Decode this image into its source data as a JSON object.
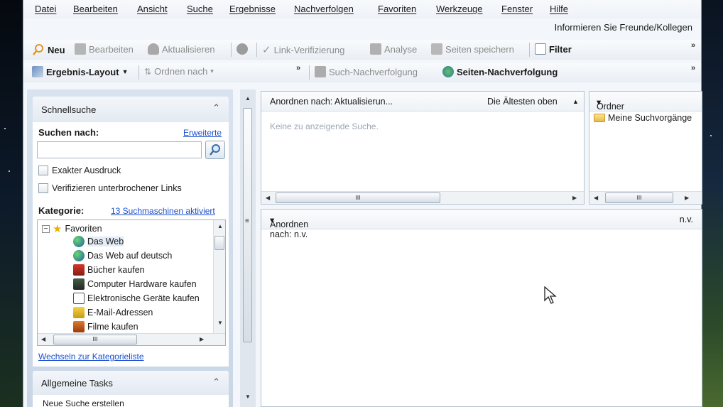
{
  "menu": [
    "Datei",
    "Bearbeiten",
    "Ansicht",
    "Suche",
    "Ergebnisse",
    "Nachverfolgen",
    "Favoriten",
    "Werkzeuge",
    "Fenster",
    "Hilfe"
  ],
  "invite_link": "Informieren Sie Freunde/Kollegen",
  "toolbar1": {
    "new": "Neu",
    "edit": "Bearbeiten",
    "refresh": "Aktualisieren",
    "link_verify": "Link-Verifizierung",
    "analyze": "Analyse",
    "save_pages": "Seiten speichern",
    "filter": "Filter",
    "overflow": "»"
  },
  "toolbar2": {
    "result_layout": "Ergebnis-Layout",
    "sort_by": "Ordnen nach",
    "overflow": "»",
    "search_tracking": "Such-Nachverfolgung",
    "page_tracking": "Seiten-Nachverfolgung",
    "overflow_right": "»"
  },
  "quicksearch": {
    "title": "Schnellsuche",
    "search_for": "Suchen nach:",
    "advanced": "Erweiterte",
    "search_value": "",
    "exact": "Exakter Ausdruck",
    "verify_links": "Verifizieren unterbrochener Links",
    "category_label": "Kategorie:",
    "engines_link": "13 Suchmaschinen aktiviert",
    "switch_link": "Wechseln zur Kategorieliste",
    "tree": {
      "root": "Favoriten",
      "items": [
        "Das Web",
        "Das Web auf deutsch",
        "Bücher kaufen",
        "Computer Hardware kaufen",
        "Elektronische Geräte kaufen",
        "E-Mail-Adressen",
        "Filme kaufen"
      ],
      "scroll_mark": "III"
    }
  },
  "tasks": {
    "title": "Allgemeine Tasks",
    "first_item": "Neue Suche erstellen"
  },
  "searches_pane": {
    "sort_label": "Anordnen nach: Aktualisierun...",
    "order_label": "Die Ältesten oben",
    "empty_text": "Keine zu anzeigende Suche.",
    "scroll_mark": "III"
  },
  "folders_pane": {
    "header": "Ordner",
    "item": "Meine Suchvorgänge",
    "scroll_mark": "III"
  },
  "results_pane": {
    "sort_label": "Anordnen nach: n.v.",
    "right_label": "n.v."
  }
}
